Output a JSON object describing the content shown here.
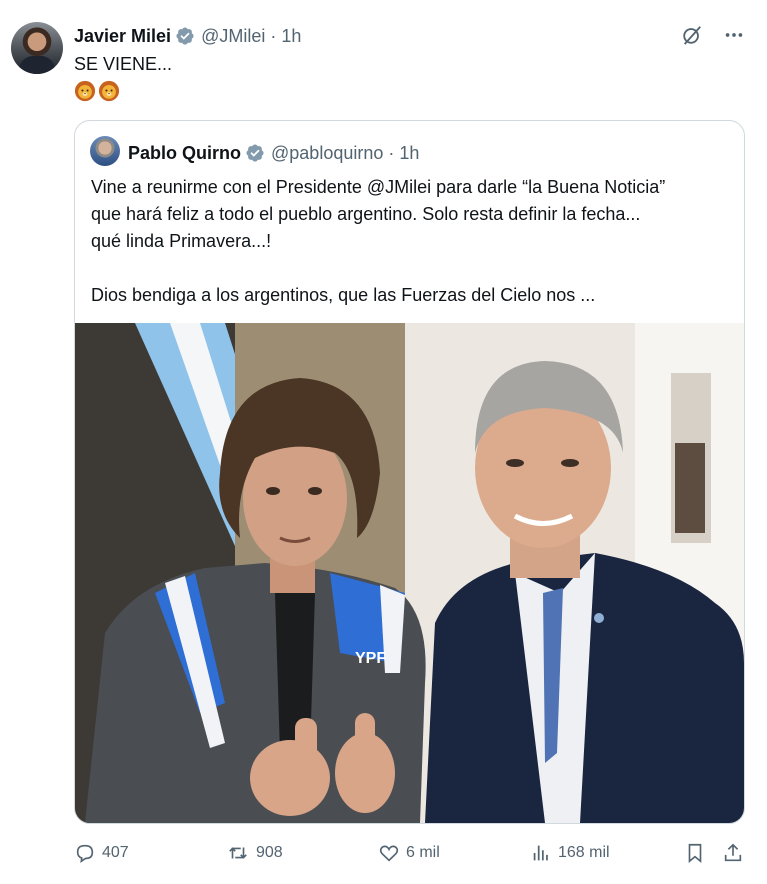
{
  "tweet": {
    "author_name": "Javier Milei",
    "handle": "@JMilei",
    "separator": "·",
    "time": "1h",
    "text": "SE VIENE...",
    "emojis": [
      "lion-face",
      "lion-face"
    ]
  },
  "quote": {
    "author_name": "Pablo Quirno",
    "handle": "@pabloquirno",
    "separator": "·",
    "time": "1h",
    "lines": [
      "Vine a reunirme con el Presidente @JMilei para darle “la Buena Noticia”",
      "que hará feliz a todo el pueblo argentino. Solo resta definir la fecha...",
      "qué linda Primavera...!"
    ],
    "line_last": "Dios bendiga a los argentinos, que las Fuerzas del  Cielo nos ..."
  },
  "photo": {
    "jacket_logo": "YPF"
  },
  "actions": {
    "replies": "407",
    "reposts": "908",
    "likes": "6 mil",
    "views": "168 mil"
  },
  "colors": {
    "text": "#0f1419",
    "muted": "#536471",
    "verified": "#829aab",
    "border": "#cfd9de"
  },
  "icons": [
    "verified-badge-icon",
    "grok-icon",
    "more-icon",
    "reply-icon",
    "repost-icon",
    "like-icon",
    "views-icon",
    "bookmark-icon",
    "share-icon"
  ]
}
